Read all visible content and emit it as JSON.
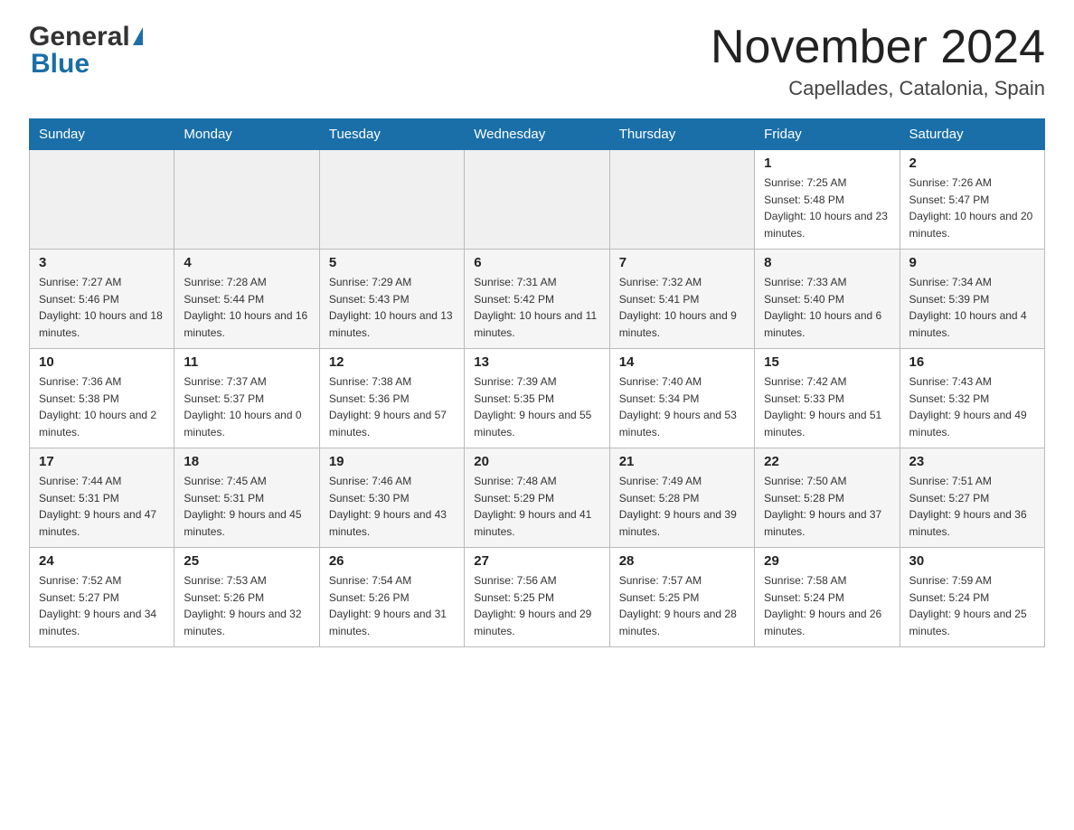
{
  "header": {
    "logo_general": "General",
    "logo_blue": "Blue",
    "month_title": "November 2024",
    "location": "Capellades, Catalonia, Spain"
  },
  "days_of_week": [
    "Sunday",
    "Monday",
    "Tuesday",
    "Wednesday",
    "Thursday",
    "Friday",
    "Saturday"
  ],
  "weeks": [
    {
      "row_class": "row-odd",
      "days": [
        {
          "number": "",
          "info": ""
        },
        {
          "number": "",
          "info": ""
        },
        {
          "number": "",
          "info": ""
        },
        {
          "number": "",
          "info": ""
        },
        {
          "number": "",
          "info": ""
        },
        {
          "number": "1",
          "info": "Sunrise: 7:25 AM\nSunset: 5:48 PM\nDaylight: 10 hours and 23 minutes."
        },
        {
          "number": "2",
          "info": "Sunrise: 7:26 AM\nSunset: 5:47 PM\nDaylight: 10 hours and 20 minutes."
        }
      ]
    },
    {
      "row_class": "row-even",
      "days": [
        {
          "number": "3",
          "info": "Sunrise: 7:27 AM\nSunset: 5:46 PM\nDaylight: 10 hours and 18 minutes."
        },
        {
          "number": "4",
          "info": "Sunrise: 7:28 AM\nSunset: 5:44 PM\nDaylight: 10 hours and 16 minutes."
        },
        {
          "number": "5",
          "info": "Sunrise: 7:29 AM\nSunset: 5:43 PM\nDaylight: 10 hours and 13 minutes."
        },
        {
          "number": "6",
          "info": "Sunrise: 7:31 AM\nSunset: 5:42 PM\nDaylight: 10 hours and 11 minutes."
        },
        {
          "number": "7",
          "info": "Sunrise: 7:32 AM\nSunset: 5:41 PM\nDaylight: 10 hours and 9 minutes."
        },
        {
          "number": "8",
          "info": "Sunrise: 7:33 AM\nSunset: 5:40 PM\nDaylight: 10 hours and 6 minutes."
        },
        {
          "number": "9",
          "info": "Sunrise: 7:34 AM\nSunset: 5:39 PM\nDaylight: 10 hours and 4 minutes."
        }
      ]
    },
    {
      "row_class": "row-odd",
      "days": [
        {
          "number": "10",
          "info": "Sunrise: 7:36 AM\nSunset: 5:38 PM\nDaylight: 10 hours and 2 minutes."
        },
        {
          "number": "11",
          "info": "Sunrise: 7:37 AM\nSunset: 5:37 PM\nDaylight: 10 hours and 0 minutes."
        },
        {
          "number": "12",
          "info": "Sunrise: 7:38 AM\nSunset: 5:36 PM\nDaylight: 9 hours and 57 minutes."
        },
        {
          "number": "13",
          "info": "Sunrise: 7:39 AM\nSunset: 5:35 PM\nDaylight: 9 hours and 55 minutes."
        },
        {
          "number": "14",
          "info": "Sunrise: 7:40 AM\nSunset: 5:34 PM\nDaylight: 9 hours and 53 minutes."
        },
        {
          "number": "15",
          "info": "Sunrise: 7:42 AM\nSunset: 5:33 PM\nDaylight: 9 hours and 51 minutes."
        },
        {
          "number": "16",
          "info": "Sunrise: 7:43 AM\nSunset: 5:32 PM\nDaylight: 9 hours and 49 minutes."
        }
      ]
    },
    {
      "row_class": "row-even",
      "days": [
        {
          "number": "17",
          "info": "Sunrise: 7:44 AM\nSunset: 5:31 PM\nDaylight: 9 hours and 47 minutes."
        },
        {
          "number": "18",
          "info": "Sunrise: 7:45 AM\nSunset: 5:31 PM\nDaylight: 9 hours and 45 minutes."
        },
        {
          "number": "19",
          "info": "Sunrise: 7:46 AM\nSunset: 5:30 PM\nDaylight: 9 hours and 43 minutes."
        },
        {
          "number": "20",
          "info": "Sunrise: 7:48 AM\nSunset: 5:29 PM\nDaylight: 9 hours and 41 minutes."
        },
        {
          "number": "21",
          "info": "Sunrise: 7:49 AM\nSunset: 5:28 PM\nDaylight: 9 hours and 39 minutes."
        },
        {
          "number": "22",
          "info": "Sunrise: 7:50 AM\nSunset: 5:28 PM\nDaylight: 9 hours and 37 minutes."
        },
        {
          "number": "23",
          "info": "Sunrise: 7:51 AM\nSunset: 5:27 PM\nDaylight: 9 hours and 36 minutes."
        }
      ]
    },
    {
      "row_class": "row-odd",
      "days": [
        {
          "number": "24",
          "info": "Sunrise: 7:52 AM\nSunset: 5:27 PM\nDaylight: 9 hours and 34 minutes."
        },
        {
          "number": "25",
          "info": "Sunrise: 7:53 AM\nSunset: 5:26 PM\nDaylight: 9 hours and 32 minutes."
        },
        {
          "number": "26",
          "info": "Sunrise: 7:54 AM\nSunset: 5:26 PM\nDaylight: 9 hours and 31 minutes."
        },
        {
          "number": "27",
          "info": "Sunrise: 7:56 AM\nSunset: 5:25 PM\nDaylight: 9 hours and 29 minutes."
        },
        {
          "number": "28",
          "info": "Sunrise: 7:57 AM\nSunset: 5:25 PM\nDaylight: 9 hours and 28 minutes."
        },
        {
          "number": "29",
          "info": "Sunrise: 7:58 AM\nSunset: 5:24 PM\nDaylight: 9 hours and 26 minutes."
        },
        {
          "number": "30",
          "info": "Sunrise: 7:59 AM\nSunset: 5:24 PM\nDaylight: 9 hours and 25 minutes."
        }
      ]
    }
  ]
}
